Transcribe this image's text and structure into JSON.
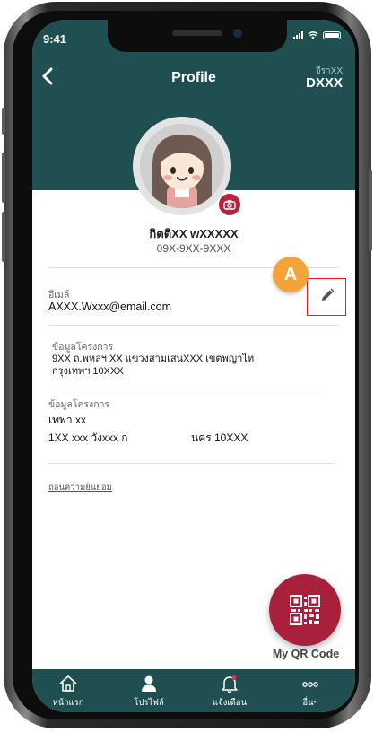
{
  "status_bar": {
    "time": "9:41"
  },
  "header": {
    "title": "Profile",
    "sub_label": "จีราXX",
    "code": "DXXX"
  },
  "profile": {
    "name": "กิตติXX wXXXXX",
    "phone": "09X-9XX-9XXX"
  },
  "marker": {
    "label": "A"
  },
  "fields": {
    "email": {
      "label": "อีเมล์",
      "value": "AXXX.Wxxx@email.com"
    },
    "project_info": {
      "label": "ข้อมูลโครงการ",
      "line1": "9XX  ถ.พหลฯ XX แขวงสามเสนXXX เขตพญาไท",
      "line2": "กรุงเทพฯ 10XXX"
    },
    "project_info_2": {
      "label": "ข้อมูลโครงการ",
      "line1": "เทพา xx",
      "line2_left": "1XX xxx วังxxx ก",
      "line2_right": "นคร  10XXX"
    }
  },
  "consent_link": "ถอนความยินยอม",
  "qr": {
    "label": "My QR Code"
  },
  "tabbar": {
    "tabs": [
      {
        "label": "หน้าแรก",
        "icon": "home-icon"
      },
      {
        "label": "โปรไฟล์",
        "icon": "user-icon"
      },
      {
        "label": "แจ้งเตือน",
        "icon": "bell-icon"
      },
      {
        "label": "อื่นๆ",
        "icon": "more-icon"
      }
    ]
  },
  "colors": {
    "header": "#1f4f50",
    "accent": "#a8203a",
    "marker": "#f2a33a",
    "highlight_box": "#e11d2e"
  }
}
